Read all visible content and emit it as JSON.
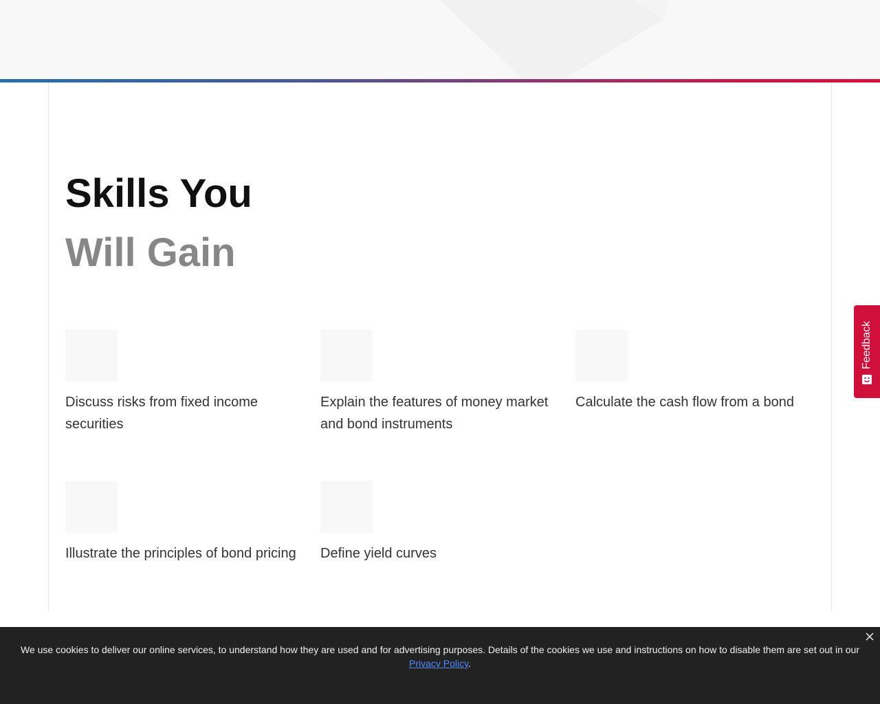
{
  "heading": {
    "line1": "Skills You",
    "line2": "Will Gain"
  },
  "skills": [
    {
      "text": "Discuss risks from fixed income securities"
    },
    {
      "text": "Explain the features of money market and bond instruments"
    },
    {
      "text": "Calculate the cash flow from a bond"
    },
    {
      "text": "Illustrate the principles of bond pricing"
    },
    {
      "text": "Define yield curves"
    }
  ],
  "feedback": {
    "label": "Feedback",
    "icon": "feedback-smiley-icon"
  },
  "cookie": {
    "text": "We use cookies to deliver our online services, to understand how they are used and for advertising purposes. Details of the cookies we use and instructions on how to disable them are set out in our ",
    "link": "Privacy Policy",
    "end": ".",
    "close_icon": "close-icon"
  },
  "colors": {
    "accent": "#d0103a",
    "heading_primary": "#111111",
    "heading_secondary": "#878787",
    "gradient_start": "#2b70a8",
    "gradient_end": "#d8103c",
    "banner_bg": "#222222",
    "link": "#4c8dff"
  }
}
